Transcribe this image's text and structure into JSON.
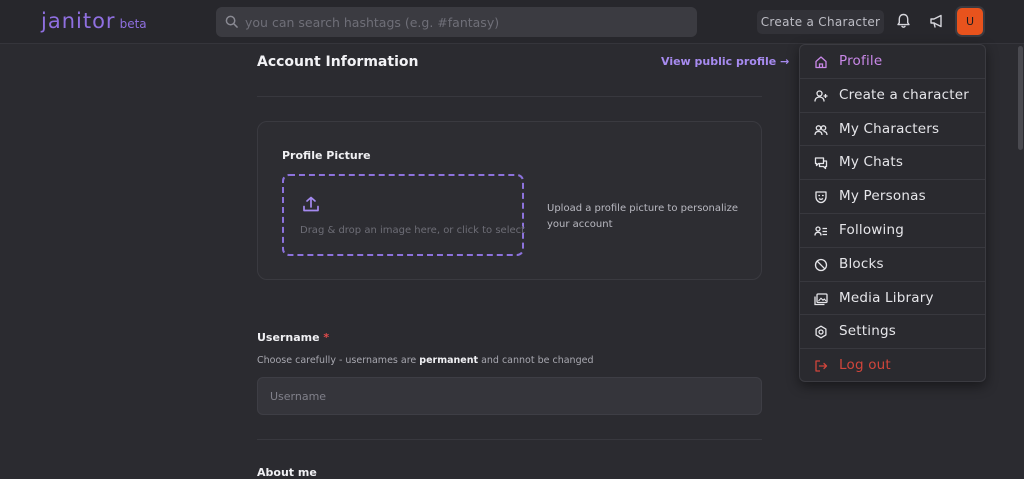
{
  "header": {
    "logo": "janitor",
    "logo_badge": "beta",
    "search_placeholder": "you can search hashtags (e.g. #fantasy)",
    "create_button": "Create a Character",
    "avatar_initial": "U"
  },
  "account": {
    "title": "Account Information",
    "public_link": "View public profile →",
    "profile_picture": {
      "title": "Profile Picture",
      "drop_text": "Drag & drop an image here, or click to select",
      "hint": "Upload a profile picture to personalize your account"
    },
    "username": {
      "label": "Username",
      "required_mark": "*",
      "help_prefix": "Choose carefully - usernames are",
      "help_bold": "permanent",
      "help_suffix": "and cannot be changed",
      "placeholder": "Username"
    },
    "about_label": "About me"
  },
  "menu": {
    "items": [
      {
        "label": "Profile",
        "icon": "home-icon"
      },
      {
        "label": "Create a character",
        "icon": "user-plus-icon"
      },
      {
        "label": "My Characters",
        "icon": "users-icon"
      },
      {
        "label": "My Chats",
        "icon": "chat-icon"
      },
      {
        "label": "My Personas",
        "icon": "mask-icon"
      },
      {
        "label": "Following",
        "icon": "following-list-icon"
      },
      {
        "label": "Blocks",
        "icon": "block-icon"
      },
      {
        "label": "Media Library",
        "icon": "media-icon"
      },
      {
        "label": "Settings",
        "icon": "gear-icon"
      },
      {
        "label": "Log out",
        "icon": "logout-icon"
      }
    ]
  },
  "colors": {
    "accent": "#8f6fe0",
    "active_menu": "#c988e8",
    "danger": "#d1453b",
    "avatar": "#e8531d"
  }
}
